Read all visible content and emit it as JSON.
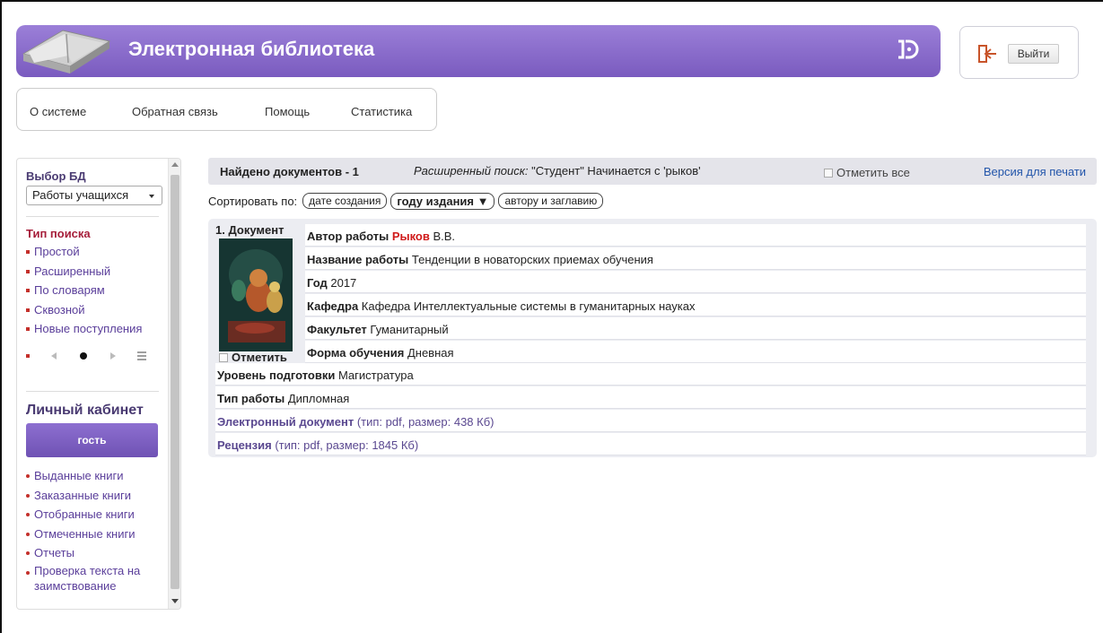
{
  "header": {
    "title": "Электронная библиотека",
    "logout_label": "Выйти"
  },
  "topnav": [
    "О системе",
    "Обратная связь",
    "Помощь",
    "Статистика"
  ],
  "sidebar": {
    "db_heading": "Выбор БД",
    "db_selected": "Работы учащихся",
    "search_heading": "Тип поиска",
    "search_types": [
      "Простой",
      "Расширенный",
      "По словарям",
      "Сквозной",
      "Новые поступления"
    ],
    "cabinet_heading": "Личный кабинет",
    "guest_label": "гость",
    "cabinet_links": [
      "Выданные книги",
      "Заказанные книги",
      "Отобранные книги",
      "Отмеченные книги",
      "Отчеты",
      "Проверка текста на заимствование"
    ]
  },
  "results": {
    "found": "Найдено документов - 1",
    "query_label": "Расширенный поиск:",
    "query_text": " \"Студент\" Начинается с 'рыков'",
    "mark_all": "Отметить все",
    "print": "Версия для печати"
  },
  "sort": {
    "label": "Сортировать по:",
    "options": [
      "дате создания",
      "году издания ▼",
      "автору и заглавию"
    ]
  },
  "document": {
    "number": "1. Документ",
    "mark": "Отметить",
    "author_label": "Автор работы",
    "author_highlight": "Рыков",
    "author_rest": " В.В.",
    "title_label": "Название работы",
    "title_value": " Тенденции в новаторских приемах обучения",
    "year_label": "Год",
    "year_value": " 2017",
    "dept_label": "Кафедра",
    "dept_value": " Кафедра Интеллектуальные системы в гуманитарных науках",
    "faculty_label": "Факультет",
    "faculty_value": " Гуманитарный",
    "form_label": "Форма обучения",
    "form_value": " Дневная",
    "level_label": "Уровень подготовки",
    "level_value": " Магистратура",
    "type_label": "Тип работы",
    "type_value": " Дипломная",
    "edoc_label": "Электронный документ",
    "edoc_info": " (тип: pdf, размер: 438 Кб)",
    "review_label": "Рецензия",
    "review_info": " (тип: pdf, размер: 1845 Кб)"
  },
  "colors": {
    "banner": "#8a6cce",
    "accent_red": "#d01a1a",
    "link_blue": "#2255aa"
  }
}
